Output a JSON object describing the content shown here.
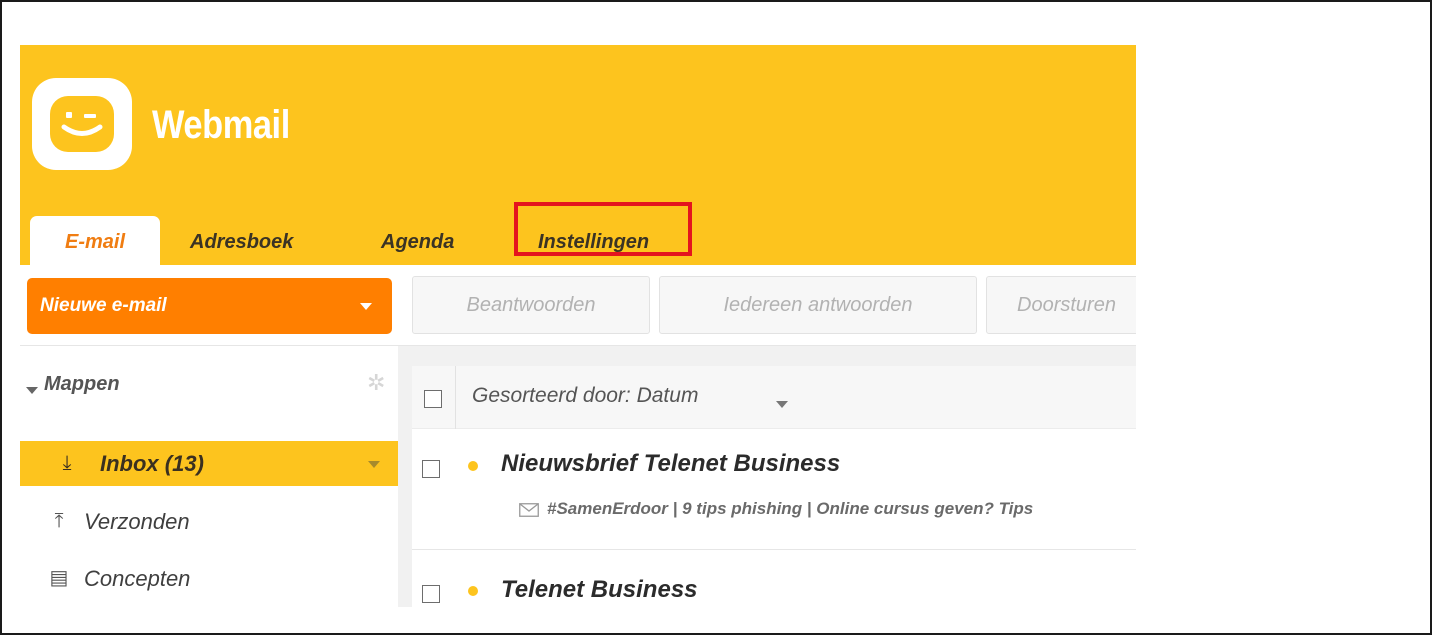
{
  "app": {
    "brand": "Webmail",
    "colors": {
      "accent_yellow": "#fdc41e",
      "orange": "#ff7f00",
      "highlight_red": "#e4141e"
    }
  },
  "tabs": [
    {
      "label": "E-mail",
      "active": true
    },
    {
      "label": "Adresboek",
      "active": false
    },
    {
      "label": "Agenda",
      "active": false
    },
    {
      "label": "Instellingen",
      "active": false,
      "highlighted": true
    }
  ],
  "toolbar": {
    "new_mail_label": "Nieuwe e-mail",
    "reply_label": "Beantwoorden",
    "reply_all_label": "Iedereen antwoorden",
    "forward_label": "Doorsturen"
  },
  "sidebar": {
    "section_label": "Mappen",
    "folders": [
      {
        "name": "Inbox (13)",
        "icon": "inbox-download-icon",
        "selected": true
      },
      {
        "name": "Verzonden",
        "icon": "sent-upload-icon",
        "selected": false
      },
      {
        "name": "Concepten",
        "icon": "draft-document-icon",
        "selected": false
      }
    ]
  },
  "list": {
    "sort_label": "Gesorteerd door: Datum",
    "messages": [
      {
        "sender": "Nieuwsbrief Telenet Business",
        "subject": "#SamenErdoor | 9 tips phishing | Online cursus geven? Tips",
        "unread": true
      },
      {
        "sender": "Telenet Business",
        "subject": "",
        "unread": true
      }
    ]
  }
}
